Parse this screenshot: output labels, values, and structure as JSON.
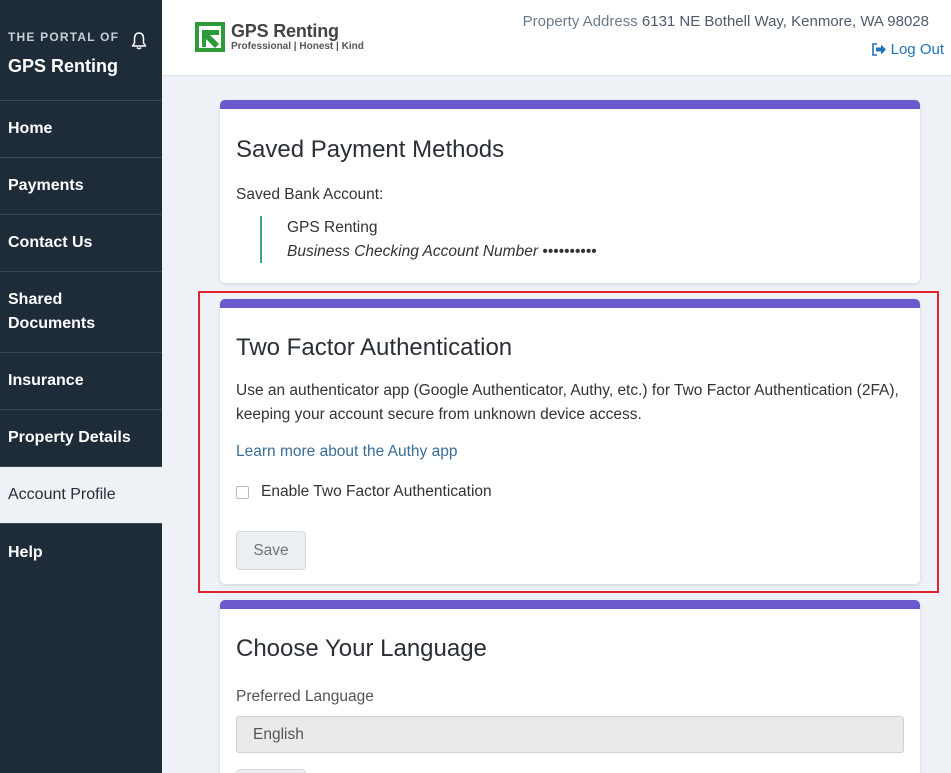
{
  "sidebar": {
    "portal_of": "THE PORTAL OF",
    "portal_name": "GPS Renting",
    "items": [
      {
        "label": "Home"
      },
      {
        "label": "Payments"
      },
      {
        "label": "Contact Us"
      },
      {
        "label": "Shared Documents"
      },
      {
        "label": "Insurance"
      },
      {
        "label": "Property Details"
      },
      {
        "label": "Account Profile",
        "active": true
      },
      {
        "label": "Help"
      }
    ]
  },
  "header": {
    "logo_name": "GPS Renting",
    "logo_tagline": "Professional | Honest | Kind",
    "address_label": "Property Address",
    "address_value": "6131 NE Bothell Way, Kenmore, WA 98028",
    "logout_label": "Log Out"
  },
  "saved_payment": {
    "title": "Saved Payment Methods",
    "saved_bank_label": "Saved Bank Account:",
    "bank_name": "GPS Renting",
    "account_desc": "Business Checking Account Number ••••••••••"
  },
  "two_factor": {
    "title": "Two Factor Authentication",
    "description": "Use an authenticator app (Google Authenticator, Authy, etc.) for Two Factor Authentication (2FA), keeping your account secure from unknown device access.",
    "learn_more": "Learn more about the Authy app",
    "enable_label": "Enable Two Factor Authentication",
    "enabled": false,
    "save_label": "Save"
  },
  "language": {
    "title": "Choose Your Language",
    "preferred_label": "Preferred Language",
    "selected": "English"
  },
  "colors": {
    "sidebar_bg": "#1e2b38",
    "card_accent": "#6a5acd",
    "highlight": "#e0262d",
    "link": "#1f73b7"
  }
}
